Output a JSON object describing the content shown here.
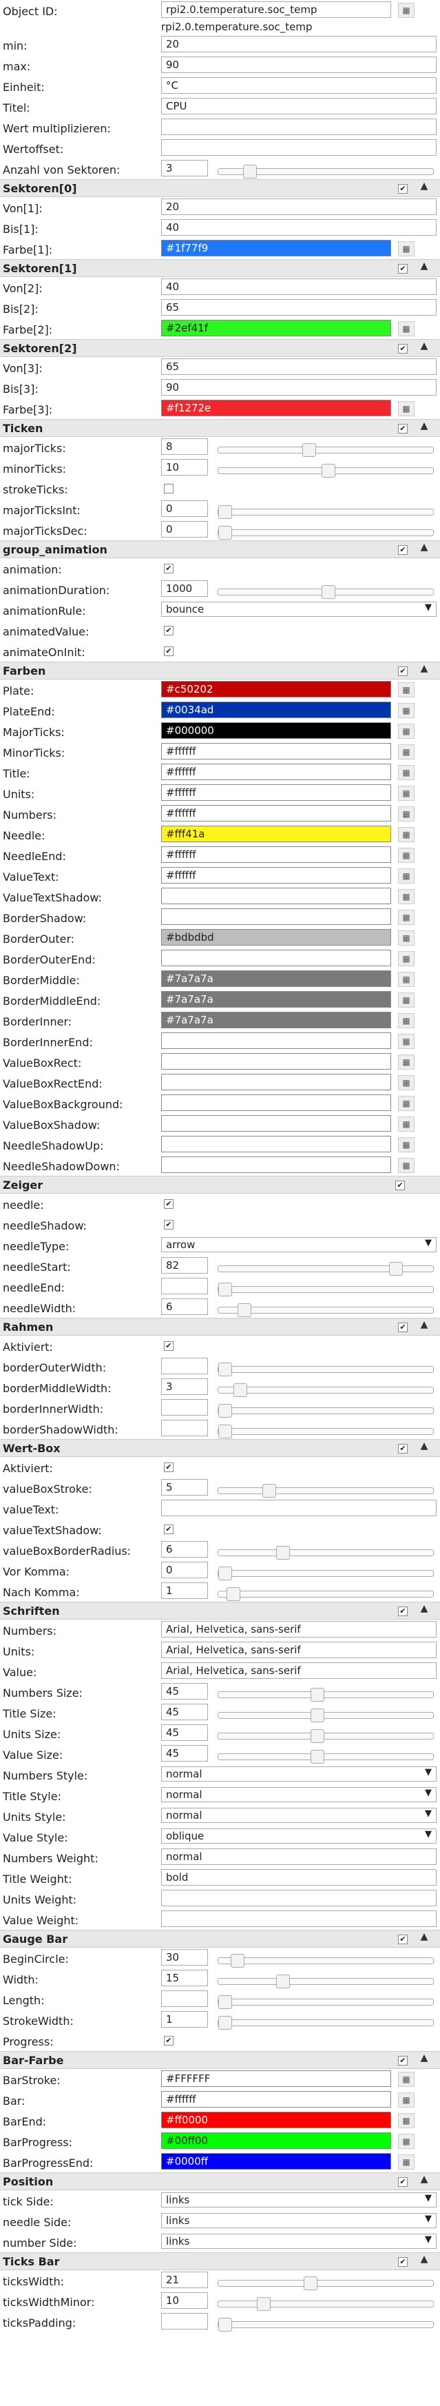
{
  "top": {
    "object_id_label": "Object ID:",
    "object_id_value": "rpi2.0.temperature.soc_temp",
    "object_id_sub": "rpi2.0.temperature.soc_temp",
    "min_label": "min:",
    "min_value": "20",
    "max_label": "max:",
    "max_value": "90",
    "unit_label": "Einheit:",
    "unit_value": "°C",
    "title_label": "Titel:",
    "title_value": "CPU",
    "multiplier_label": "Wert multiplizieren:",
    "multiplier_value": "",
    "offset_label": "Wertoffset:",
    "offset_value": "",
    "sectors_label": "Anzahl von Sektoren:",
    "sectors_value": "3"
  },
  "sectors": [
    {
      "title": "Sektoren[0]",
      "from_label": "Von[1]:",
      "from": "20",
      "to_label": "Bis[1]:",
      "to": "40",
      "color_label": "Farbe[1]:",
      "color": "#1f77f9"
    },
    {
      "title": "Sektoren[1]",
      "from_label": "Von[2]:",
      "from": "40",
      "to_label": "Bis[2]:",
      "to": "65",
      "color_label": "Farbe[2]:",
      "color": "#2ef41f"
    },
    {
      "title": "Sektoren[2]",
      "from_label": "Von[3]:",
      "from": "65",
      "to_label": "Bis[3]:",
      "to": "90",
      "color_label": "Farbe[3]:",
      "color": "#f1272e"
    }
  ],
  "ticks": {
    "title": "Ticken",
    "major_label": "majorTicks:",
    "major": "8",
    "minor_label": "minorTicks:",
    "minor": "10",
    "stroke_label": "strokeTicks:",
    "majorint_label": "majorTicksInt:",
    "majorint": "0",
    "majordec_label": "majorTicksDec:",
    "majordec": "0"
  },
  "animation": {
    "title": "group_animation",
    "animation_label": "animation:",
    "duration_label": "animationDuration:",
    "duration": "1000",
    "rule_label": "animationRule:",
    "rule": "bounce",
    "animated_label": "animatedValue:",
    "oninit_label": "animateOnInit:"
  },
  "colors": {
    "title": "Farben",
    "items": [
      {
        "label": "Plate:",
        "value": "#c50202",
        "bg": "#c50202",
        "dark": true
      },
      {
        "label": "PlateEnd:",
        "value": "#0034ad",
        "bg": "#0034ad",
        "dark": true
      },
      {
        "label": "MajorTicks:",
        "value": "#000000",
        "bg": "#000000",
        "dark": true
      },
      {
        "label": "MinorTicks:",
        "value": "#ffffff",
        "bg": "#ffffff",
        "dark": false
      },
      {
        "label": "Title:",
        "value": "#ffffff",
        "bg": "#ffffff",
        "dark": false
      },
      {
        "label": "Units:",
        "value": "#ffffff",
        "bg": "#ffffff",
        "dark": false
      },
      {
        "label": "Numbers:",
        "value": "#ffffff",
        "bg": "#ffffff",
        "dark": false
      },
      {
        "label": "Needle:",
        "value": "#fff41a",
        "bg": "#fff41a",
        "dark": false
      },
      {
        "label": "NeedleEnd:",
        "value": "#ffffff",
        "bg": "#ffffff",
        "dark": false
      },
      {
        "label": "ValueText:",
        "value": "#ffffff",
        "bg": "#ffffff",
        "dark": false
      },
      {
        "label": "ValueTextShadow:",
        "value": "",
        "bg": "#ffffff",
        "dark": false
      },
      {
        "label": "BorderShadow:",
        "value": "",
        "bg": "#ffffff",
        "dark": false
      },
      {
        "label": "BorderOuter:",
        "value": "#bdbdbd",
        "bg": "#bdbdbd",
        "dark": false
      },
      {
        "label": "BorderOuterEnd:",
        "value": "",
        "bg": "#ffffff",
        "dark": false
      },
      {
        "label": "BorderMiddle:",
        "value": "#7a7a7a",
        "bg": "#7a7a7a",
        "dark": true
      },
      {
        "label": "BorderMiddleEnd:",
        "value": "#7a7a7a",
        "bg": "#7a7a7a",
        "dark": true
      },
      {
        "label": "BorderInner:",
        "value": "#7a7a7a",
        "bg": "#7a7a7a",
        "dark": true
      },
      {
        "label": "BorderInnerEnd:",
        "value": "",
        "bg": "#ffffff",
        "dark": false
      },
      {
        "label": "ValueBoxRect:",
        "value": "",
        "bg": "#ffffff",
        "dark": false
      },
      {
        "label": "ValueBoxRectEnd:",
        "value": "",
        "bg": "#ffffff",
        "dark": false
      },
      {
        "label": "ValueBoxBackground:",
        "value": "",
        "bg": "#ffffff",
        "dark": false
      },
      {
        "label": "ValueBoxShadow:",
        "value": "",
        "bg": "#ffffff",
        "dark": false
      },
      {
        "label": "NeedleShadowUp:",
        "value": "",
        "bg": "#ffffff",
        "dark": false
      },
      {
        "label": "NeedleShadowDown:",
        "value": "",
        "bg": "#ffffff",
        "dark": false
      }
    ]
  },
  "needle": {
    "title": "Zeiger",
    "needle_label": "needle:",
    "shadow_label": "needleShadow:",
    "type_label": "needleType:",
    "type": "arrow",
    "start_label": "needleStart:",
    "start": "82",
    "end_label": "needleEnd:",
    "end": "",
    "width_label": "needleWidth:",
    "width": "6"
  },
  "frame": {
    "title": "Rahmen",
    "active_label": "Aktiviert:",
    "outer_label": "borderOuterWidth:",
    "outer": "",
    "middle_label": "borderMiddleWidth:",
    "middle": "3",
    "inner_label": "borderInnerWidth:",
    "inner": "",
    "shadow_label": "borderShadowWidth:",
    "shadow": ""
  },
  "valuebox": {
    "title": "Wert-Box",
    "active_label": "Aktiviert:",
    "stroke_label": "valueBoxStroke:",
    "stroke": "5",
    "text_label": "valueText:",
    "text": "",
    "textshadow_label": "valueTextShadow:",
    "radius_label": "valueBoxBorderRadius:",
    "radius": "6",
    "before_label": "Vor Komma:",
    "before": "0",
    "after_label": "Nach Komma:",
    "after": "1"
  },
  "fonts": {
    "title": "Schriften",
    "numbers_label": "Numbers:",
    "numbers": "Arial, Helvetica, sans-serif",
    "units_label": "Units:",
    "units": "Arial, Helvetica, sans-serif",
    "value_label": "Value:",
    "value": "Arial, Helvetica, sans-serif",
    "numsize_label": "Numbers Size:",
    "numsize": "45",
    "titlesize_label": "Title Size:",
    "titlesize": "45",
    "unitssize_label": "Units Size:",
    "unitssize": "45",
    "valuesize_label": "Value Size:",
    "valuesize": "45",
    "numstyle_label": "Numbers Style:",
    "numstyle": "normal",
    "titlestyle_label": "Title Style:",
    "titlestyle": "normal",
    "unitsstyle_label": "Units Style:",
    "unitsstyle": "normal",
    "valuestyle_label": "Value Style:",
    "valuestyle": "oblique",
    "numweight_label": "Numbers Weight:",
    "numweight": "normal",
    "titleweight_label": "Title Weight:",
    "titleweight": "bold",
    "unitsweight_label": "Units Weight:",
    "unitsweight": "",
    "valueweight_label": "Value Weight:",
    "valueweight": ""
  },
  "gaugebar": {
    "title": "Gauge Bar",
    "begin_label": "BeginCircle:",
    "begin": "30",
    "width_label": "Width:",
    "width": "15",
    "length_label": "Length:",
    "length": "",
    "stroke_label": "StrokeWidth:",
    "stroke": "1",
    "progress_label": "Progress:"
  },
  "barcolors": {
    "title": "Bar-Farbe",
    "items": [
      {
        "label": "BarStroke:",
        "value": "#FFFFFF",
        "bg": "#ffffff",
        "dark": false
      },
      {
        "label": "Bar:",
        "value": "#ffffff",
        "bg": "#ffffff",
        "dark": false
      },
      {
        "label": "BarEnd:",
        "value": "#ff0000",
        "bg": "#ff0000",
        "dark": true
      },
      {
        "label": "BarProgress:",
        "value": "#00ff00",
        "bg": "#00ff00",
        "dark": false
      },
      {
        "label": "BarProgressEnd:",
        "value": "#0000ff",
        "bg": "#0000ff",
        "dark": true
      }
    ]
  },
  "position": {
    "title": "Position",
    "tick_label": "tick Side:",
    "tick": "links",
    "needle_label": "needle Side:",
    "needle": "links",
    "number_label": "number Side:",
    "number": "links"
  },
  "ticksbar": {
    "title": "Ticks Bar",
    "width_label": "ticksWidth:",
    "width": "21",
    "minor_label": "ticksWidthMinor:",
    "minor": "10",
    "padding_label": "ticksPadding:",
    "padding": ""
  },
  "symbols": {
    "check": "✔",
    "chevron": "▲",
    "dropdown": "▼",
    "grid": "▦"
  }
}
